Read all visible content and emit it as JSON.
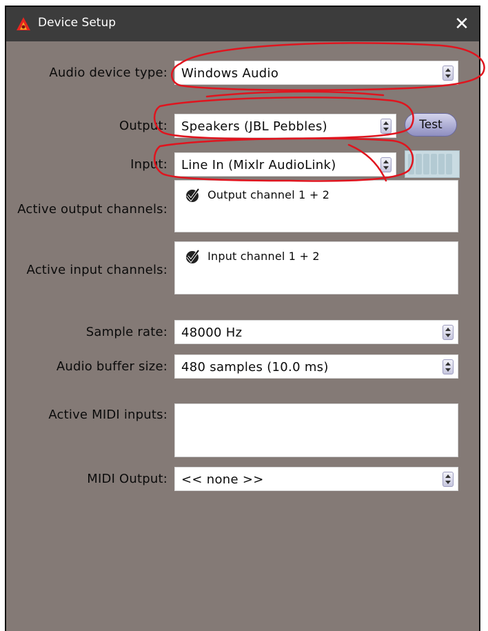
{
  "window": {
    "title": "Device Setup",
    "close_glyph": "✕"
  },
  "form": {
    "audio_device_type": {
      "label": "Audio device type:",
      "value": "Windows Audio"
    },
    "output": {
      "label": "Output:",
      "value": "Speakers (JBL Pebbles)",
      "test_label": "Test"
    },
    "input": {
      "label": "Input:",
      "value": "Line In (Mixlr AudioLink)"
    },
    "active_output_channels": {
      "label": "Active output channels:",
      "items": [
        {
          "label": "Output channel 1 + 2",
          "checked": true
        }
      ]
    },
    "active_input_channels": {
      "label": "Active input channels:",
      "items": [
        {
          "label": "Input channel 1 + 2",
          "checked": true
        }
      ]
    },
    "sample_rate": {
      "label": "Sample rate:",
      "value": "48000 Hz"
    },
    "audio_buffer_size": {
      "label": "Audio buffer size:",
      "value": "480 samples (10.0 ms)"
    },
    "active_midi_inputs": {
      "label": "Active MIDI inputs:",
      "items": []
    },
    "midi_output": {
      "label": "MIDI Output:",
      "value": "<< none >>"
    }
  },
  "icons": {
    "app": "red-triangle-app-icon",
    "close": "close-icon",
    "combo_arrows": "up-down-arrows-icon",
    "checkbox": "checkbox-checked-icon"
  },
  "colors": {
    "window_bg": "#847a76",
    "titlebar_bg": "#3c3c3c",
    "annotation": "#e0141e",
    "test_button": "#a8a8d4"
  }
}
